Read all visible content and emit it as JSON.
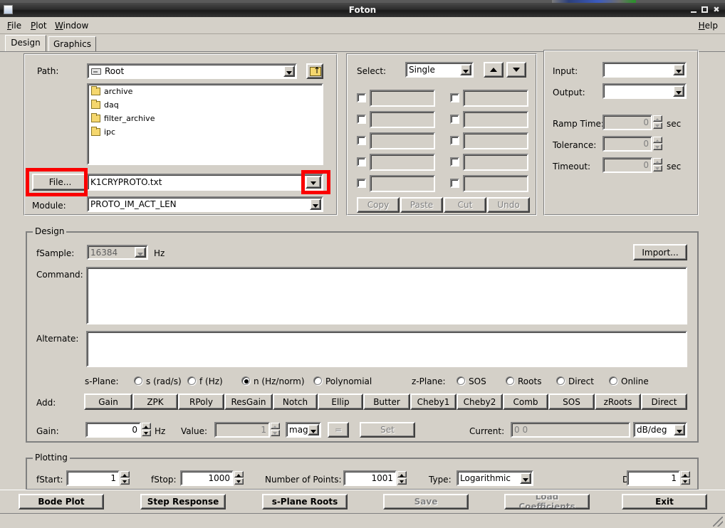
{
  "window": {
    "title": "Foton",
    "icon": "window-icon",
    "minimize": "minimize-icon",
    "maximize": "maximize-icon",
    "close": "close-icon"
  },
  "menubar": {
    "items": [
      {
        "label": "File",
        "mnemonic": "F"
      },
      {
        "label": "Plot",
        "mnemonic": "P"
      },
      {
        "label": "Window",
        "mnemonic": "W"
      }
    ],
    "help": {
      "label": "Help",
      "mnemonic": "H"
    }
  },
  "tabs": [
    {
      "label": "Design",
      "active": true
    },
    {
      "label": "Graphics",
      "active": false
    }
  ],
  "file_panel": {
    "path_label": "Path:",
    "path_value": "Root",
    "path_icon": "drive-icon",
    "updir_icon": "up-directory-icon",
    "folders": [
      {
        "name": "archive"
      },
      {
        "name": "daq"
      },
      {
        "name": "filter_archive"
      },
      {
        "name": "ipc"
      }
    ],
    "file_button": "File...",
    "file_value": "K1CRYPROTO.txt",
    "module_label": "Module:",
    "module_value": "PROTO_IM_ACT_LEN"
  },
  "filter_panel": {
    "select_label": "Select:",
    "select_value": "Single",
    "up_icon": "arrow-up-icon",
    "down_icon": "arrow-down-icon",
    "rows": [
      {
        "left_checked": false,
        "left_value": "",
        "right_checked": false,
        "right_value": ""
      },
      {
        "left_checked": false,
        "left_value": "",
        "right_checked": false,
        "right_value": ""
      },
      {
        "left_checked": false,
        "left_value": "",
        "right_checked": false,
        "right_value": ""
      },
      {
        "left_checked": false,
        "left_value": "",
        "right_checked": false,
        "right_value": ""
      },
      {
        "left_checked": false,
        "left_value": "",
        "right_checked": false,
        "right_value": ""
      }
    ],
    "buttons": [
      {
        "label": "Copy",
        "enabled": false
      },
      {
        "label": "Paste",
        "enabled": false
      },
      {
        "label": "Cut",
        "enabled": false
      },
      {
        "label": "Undo",
        "enabled": false
      }
    ]
  },
  "io_panel": {
    "input_label": "Input:",
    "input_value": "",
    "output_label": "Output:",
    "output_value": "",
    "ramp_time_label": "Ramp Time:",
    "ramp_time_value": "0",
    "ramp_time_unit": "sec",
    "tolerance_label": "Tolerance:",
    "tolerance_value": "0",
    "timeout_label": "Timeout:",
    "timeout_value": "0",
    "timeout_unit": "sec"
  },
  "design": {
    "group_label": "Design",
    "fsample_label": "fSample:",
    "fsample_value": "16384",
    "fsample_unit": "Hz",
    "import_button": "Import...",
    "command_label": "Command:",
    "command_value": "",
    "alternate_label": "Alternate:",
    "alternate_value": "",
    "splane_label": "s-Plane:",
    "splane_options": [
      {
        "label": "s (rad/s)",
        "selected": false
      },
      {
        "label": "f (Hz)",
        "selected": false
      },
      {
        "label": "n (Hz/norm)",
        "selected": true
      },
      {
        "label": "Polynomial",
        "selected": false
      }
    ],
    "zplane_label": "z-Plane:",
    "zplane_options": [
      {
        "label": "SOS",
        "selected": false
      },
      {
        "label": "Roots",
        "selected": false
      },
      {
        "label": "Direct",
        "selected": false
      },
      {
        "label": "Online",
        "selected": false
      }
    ],
    "add_label": "Add:",
    "add_buttons": [
      "Gain",
      "ZPK",
      "RPoly",
      "ResGain",
      "Notch",
      "Ellip",
      "Butter",
      "Cheby1",
      "Cheby2",
      "Comb",
      "SOS",
      "zRoots",
      "Direct"
    ],
    "gain_label": "Gain:",
    "gain_value": "0",
    "gain_unit": "Hz",
    "value_label": "Value:",
    "value_value": "1",
    "value_units": "mag",
    "equals_button": "=",
    "set_button": "Set",
    "current_label": "Current:",
    "current_value": "0  0",
    "current_units": "dB/deg"
  },
  "plotting": {
    "group_label": "Plotting",
    "fstart_label": "fStart:",
    "fstart_value": "1",
    "fstop_label": "fStop:",
    "fstop_value": "1000",
    "points_label": "Number of Points:",
    "points_value": "1001",
    "type_label": "Type:",
    "type_value": "Logarithmic",
    "duration_label": "Duration:",
    "duration_value": "1"
  },
  "bottom_buttons": [
    {
      "label": "Bode Plot",
      "enabled": true
    },
    {
      "label": "Step Response",
      "enabled": true
    },
    {
      "label": "s-Plane Roots",
      "enabled": true
    },
    {
      "label": "Save",
      "enabled": false
    },
    {
      "label": "Load Coefficients",
      "enabled": false
    },
    {
      "label": "Exit",
      "enabled": true
    }
  ],
  "annotations": {
    "highlight_color": "#fa0000",
    "boxes": [
      {
        "target": "file-button"
      },
      {
        "target": "file-dropdown-arrow"
      }
    ]
  }
}
